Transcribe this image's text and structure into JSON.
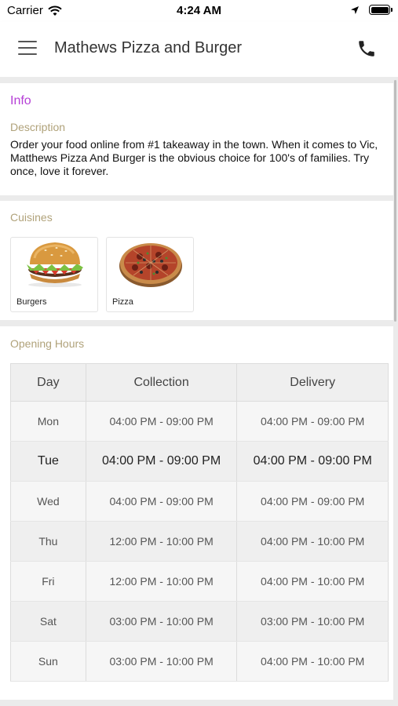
{
  "status_bar": {
    "carrier": "Carrier",
    "time": "4:24 AM"
  },
  "nav": {
    "title": "Mathews Pizza and Burger",
    "menu_icon": "hamburger-menu-icon",
    "call_icon": "phone-icon"
  },
  "info": {
    "title": "Info",
    "description_label": "Description",
    "description": "Order your food online from #1 takeaway in the town. When it comes to Vic, Matthews Pizza And Burger is the obvious choice for 100's of families. Try once, love it forever."
  },
  "cuisines": {
    "label": "Cuisines",
    "items": [
      {
        "name": "Burgers",
        "image": "burger-image"
      },
      {
        "name": "Pizza",
        "image": "pizza-image"
      }
    ]
  },
  "hours": {
    "label": "Opening Hours",
    "headers": [
      "Day",
      "Collection",
      "Delivery"
    ],
    "rows": [
      {
        "day": "Mon",
        "collection": "04:00 PM - 09:00 PM",
        "delivery": "04:00 PM - 09:00 PM"
      },
      {
        "day": "Tue",
        "collection": "04:00 PM - 09:00 PM",
        "delivery": "04:00 PM - 09:00 PM"
      },
      {
        "day": "Wed",
        "collection": "04:00 PM - 09:00 PM",
        "delivery": "04:00 PM - 09:00 PM"
      },
      {
        "day": "Thu",
        "collection": "12:00 PM - 10:00 PM",
        "delivery": "04:00 PM - 10:00 PM"
      },
      {
        "day": "Fri",
        "collection": "12:00 PM - 10:00 PM",
        "delivery": "04:00 PM - 10:00 PM"
      },
      {
        "day": "Sat",
        "collection": "03:00 PM - 10:00 PM",
        "delivery": "03:00 PM - 10:00 PM"
      },
      {
        "day": "Sun",
        "collection": "03:00 PM - 10:00 PM",
        "delivery": "04:00 PM - 10:00 PM"
      }
    ]
  },
  "colors": {
    "info_title": "#b53fd6",
    "section_label": "#b0a27a",
    "background": "#ebebeb"
  }
}
